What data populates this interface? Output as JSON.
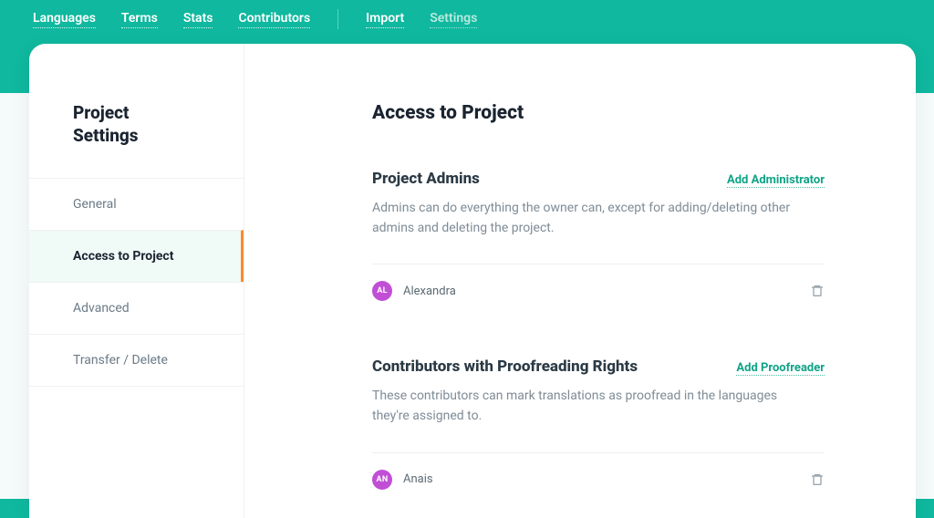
{
  "nav": {
    "items": [
      {
        "label": "Languages"
      },
      {
        "label": "Terms"
      },
      {
        "label": "Stats"
      },
      {
        "label": "Contributors"
      }
    ],
    "secondary": [
      {
        "label": "Import"
      },
      {
        "label": "Settings",
        "active": true
      }
    ]
  },
  "sidebar": {
    "title_line1": "Project",
    "title_line2": "Settings",
    "items": [
      {
        "label": "General"
      },
      {
        "label": "Access to Project",
        "active": true
      },
      {
        "label": "Advanced"
      },
      {
        "label": "Transfer / Delete"
      }
    ]
  },
  "main": {
    "title": "Access to Project",
    "admins": {
      "heading": "Project Admins",
      "add_link": "Add Administrator",
      "description": "Admins can do everything the owner can, except for adding/deleting other admins and deleting the project.",
      "users": [
        {
          "initials": "AL",
          "name": "Alexandra"
        }
      ]
    },
    "proofreaders": {
      "heading": "Contributors with Proofreading Rights",
      "add_link": "Add Proofreader",
      "description": "These contributors can mark translations as proofread in the languages they're assigned to.",
      "users": [
        {
          "initials": "AN",
          "name": "Anais"
        }
      ]
    }
  }
}
